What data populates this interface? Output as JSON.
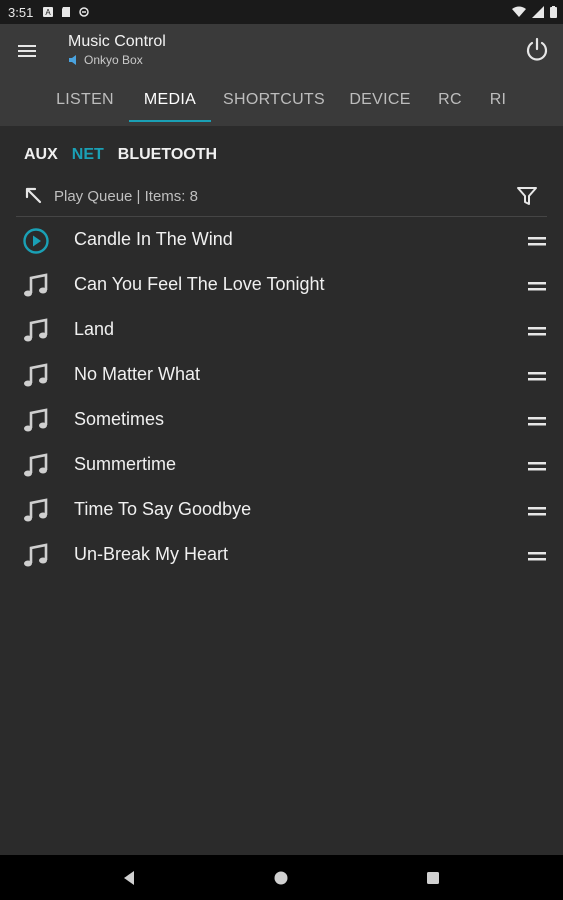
{
  "status_bar": {
    "time": "3:51"
  },
  "app_bar": {
    "title": "Music Control",
    "subtitle": "Onkyo Box"
  },
  "tabs": [
    {
      "label": "LISTEN"
    },
    {
      "label": "MEDIA"
    },
    {
      "label": "SHORTCUTS"
    },
    {
      "label": "DEVICE"
    },
    {
      "label": "RC"
    },
    {
      "label": "RI"
    }
  ],
  "active_tab": "MEDIA",
  "sources": [
    {
      "label": "AUX"
    },
    {
      "label": "NET"
    },
    {
      "label": "BLUETOOTH"
    }
  ],
  "active_source": "NET",
  "queue": {
    "title": "Play Queue | Items: 8"
  },
  "tracks": [
    {
      "title": "Candle In The Wind",
      "icon": "play-circle-icon"
    },
    {
      "title": "Can You Feel The Love Tonight",
      "icon": "music-note-icon"
    },
    {
      "title": "Land",
      "icon": "music-note-icon"
    },
    {
      "title": "No Matter What",
      "icon": "music-note-icon"
    },
    {
      "title": "Sometimes",
      "icon": "music-note-icon"
    },
    {
      "title": "Summertime",
      "icon": "music-note-icon"
    },
    {
      "title": "Time To Say Goodbye",
      "icon": "music-note-icon"
    },
    {
      "title": "Un-Break My Heart",
      "icon": "music-note-icon"
    }
  ],
  "colors": {
    "accent": "#1aa0b5",
    "background": "#2b2b2b",
    "appbar": "#3a3a3a"
  }
}
